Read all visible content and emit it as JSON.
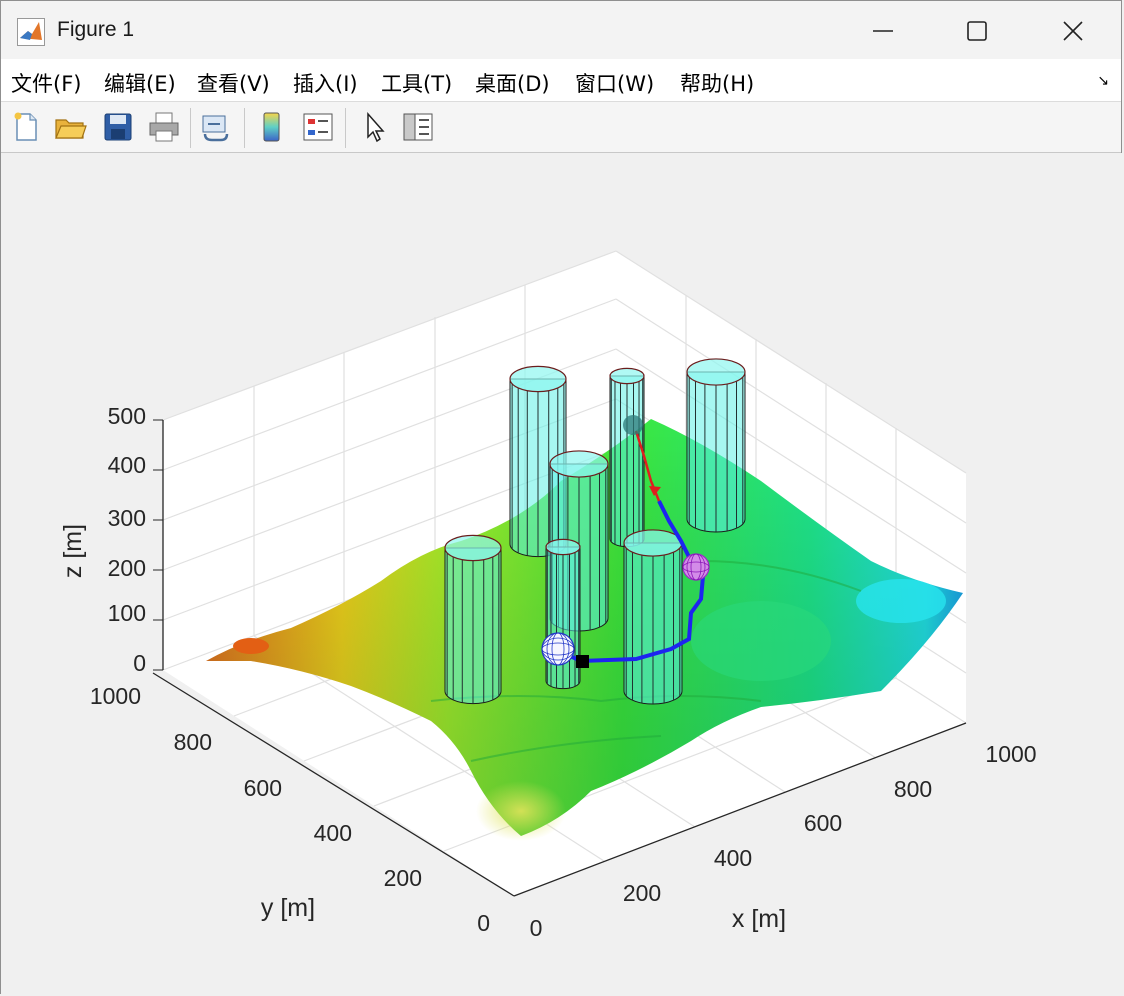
{
  "window": {
    "title": "Figure 1"
  },
  "menu": [
    "文件(F)",
    "编辑(E)",
    "查看(V)",
    "插入(I)",
    "工具(T)",
    "桌面(D)",
    "窗口(W)",
    "帮助(H)"
  ],
  "toolbar": [
    "new-file-icon",
    "open-folder-icon",
    "save-icon",
    "print-icon",
    "link-icon",
    "colorbar-icon",
    "legend-icon",
    "pointer-icon",
    "property-inspector-icon"
  ],
  "chart_data": {
    "type": "surface3d",
    "xlabel": "x [m]",
    "ylabel": "y [m]",
    "zlabel": "z [m]",
    "xticks": [
      "0",
      "200",
      "400",
      "600",
      "800",
      "1000"
    ],
    "yticks": [
      "0",
      "200",
      "400",
      "600",
      "800",
      "1000"
    ],
    "zticks": [
      "0",
      "100",
      "200",
      "300",
      "400",
      "500"
    ],
    "xlim": [
      0,
      1000
    ],
    "ylim": [
      0,
      1000
    ],
    "zlim": [
      0,
      500
    ],
    "grid": true,
    "colormap": "jet",
    "obstacles": "7 cyan cylinders",
    "path": "blue path with red segment",
    "start_marker": "black square",
    "spheres": [
      "blue wireframe sphere",
      "magenta wireframe sphere",
      "dark translucent sphere"
    ]
  }
}
